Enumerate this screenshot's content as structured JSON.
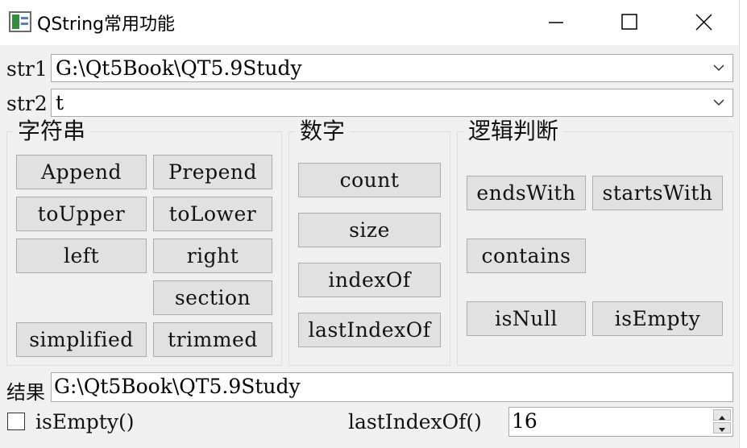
{
  "window": {
    "title": "QString常用功能",
    "controls": {
      "minimize_icon": "minimize-icon",
      "maximize_icon": "maximize-icon",
      "close_icon": "close-icon"
    }
  },
  "inputs": {
    "str1": {
      "label": "str1",
      "value": "G:\\Qt5Book\\QT5.9Study"
    },
    "str2": {
      "label": "str2",
      "value": "t"
    }
  },
  "groups": {
    "string": {
      "title": "字符串",
      "buttons": [
        "Append",
        "Prepend",
        "toUpper",
        "toLower",
        "left",
        "right",
        "section",
        "simplified",
        "trimmed"
      ]
    },
    "number": {
      "title": "数字",
      "buttons": [
        "count",
        "size",
        "indexOf",
        "lastIndexOf"
      ]
    },
    "logic": {
      "title": "逻辑判断",
      "buttons": [
        "endsWith",
        "startsWith",
        "contains",
        "isNull",
        "isEmpty"
      ]
    }
  },
  "result": {
    "label": "结果",
    "value": "G:\\Qt5Book\\QT5.9Study"
  },
  "bottom": {
    "checkbox_label": "isEmpty()",
    "checkbox_checked": false,
    "spin_label": "lastIndexOf()",
    "spin_value": "16"
  },
  "colors": {
    "button_bg": "#e1e1e1",
    "window_bg": "#f0f0f0",
    "border": "#adadad"
  }
}
